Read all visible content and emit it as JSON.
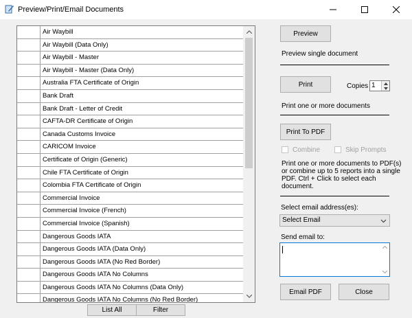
{
  "window": {
    "title": "Preview/Print/Email Documents",
    "icon": "pen-document-icon"
  },
  "documents": [
    "Air Waybill",
    "Air Waybill  (Data Only)",
    "Air Waybill - Master",
    "Air Waybill - Master (Data Only)",
    "Australia FTA Certificate of Origin",
    "Bank Draft",
    "Bank Draft - Letter of Credit",
    "CAFTA-DR Certificate of Origin",
    "Canada Customs Invoice",
    "CARICOM Invoice",
    "Certificate of Origin (Generic)",
    "Chile FTA Certificate of Origin",
    "Colombia FTA Certificate of Origin",
    "Commercial Invoice",
    "Commercial Invoice (French)",
    "Commercial Invoice (Spanish)",
    "Dangerous Goods IATA",
    "Dangerous Goods IATA (Data Only)",
    "Dangerous Goods IATA (No Red Border)",
    "Dangerous Goods IATA No Columns",
    "Dangerous Goods IATA No Columns (Data Only)",
    "Dangerous Goods IATA No Columns (No Red Border)"
  ],
  "list_buttons": {
    "list_all": "List All",
    "filter": "Filter"
  },
  "preview": {
    "button": "Preview",
    "description": "Preview single document"
  },
  "print": {
    "button": "Print",
    "copies_label": "Copies",
    "copies_value": "1",
    "description": "Print one or more documents"
  },
  "pdf": {
    "button": "Print To PDF",
    "combine_label": "Combine",
    "skip_prompts_label": "Skip Prompts",
    "description_lines": [
      "Print one or more documents to PDF(s)",
      "or combine up to 5 reports into a single",
      "PDF.  Ctrl + Click to select each",
      "document."
    ]
  },
  "email": {
    "select_label": "Select email address(es):",
    "select_value": "Select Email",
    "send_to_label": "Send email to:",
    "send_to_value": "",
    "email_button": "Email PDF",
    "close_button": "Close"
  }
}
